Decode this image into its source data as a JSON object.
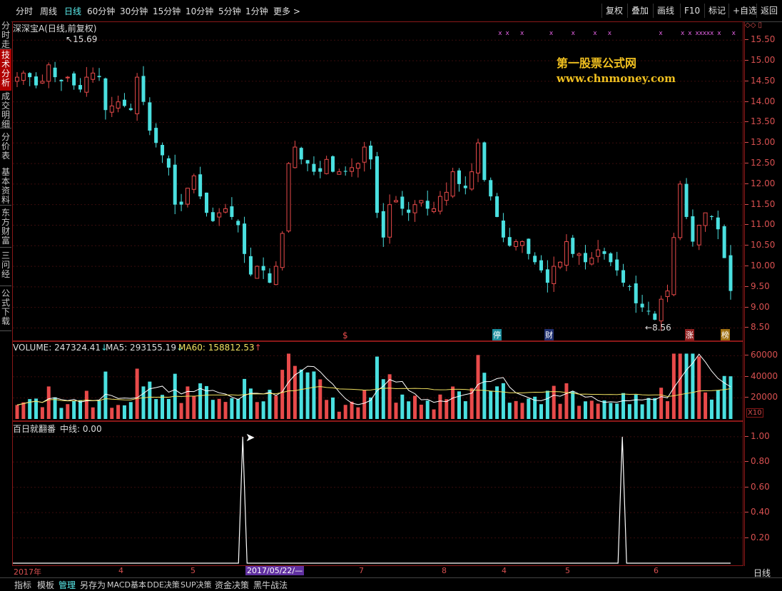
{
  "topbar": {
    "periods": [
      "分时",
      "周线",
      "日线",
      "60分钟",
      "30分钟",
      "15分钟",
      "10分钟",
      "5分钟",
      "1分钟",
      "更多 >"
    ],
    "active_period": "日线",
    "right_buttons": [
      "复权",
      "叠加",
      "画线",
      "F10",
      "标记",
      "+自选",
      "返回"
    ]
  },
  "sidebar": {
    "tabs": [
      "分时走势",
      "技术分析",
      "成交明细",
      "分价表",
      "基本资料",
      "东方财富",
      "三问经",
      "公式下载"
    ],
    "active": "技术分析"
  },
  "main": {
    "title": "深深宝A(日线,前复权)",
    "high_label": "15.69",
    "low_label": "8.56",
    "watermark_line1": "第一股票公式网",
    "watermark_line2": "www.chnmoney.com",
    "event_marks": [
      "$",
      "停",
      "财",
      "涨",
      "榜"
    ],
    "yticks": [
      "15.50",
      "15.00",
      "14.50",
      "14.00",
      "13.50",
      "13.00",
      "12.50",
      "12.00",
      "11.50",
      "11.00",
      "10.50",
      "10.00",
      "9.50",
      "9.00",
      "8.50"
    ]
  },
  "volume": {
    "label_volume": "VOLUME: 247324.41",
    "label_ma5": "MA5: 293155.19",
    "label_ma60": "MA60: 158812.53",
    "yticks": [
      "60000",
      "40000",
      "20000"
    ],
    "unit": "X10"
  },
  "indicator": {
    "label_name": "百日就翻番",
    "label_mid": "中线: 0.00",
    "yticks": [
      "1.00",
      "0.80",
      "0.60",
      "0.40",
      "0.20"
    ]
  },
  "date_axis": {
    "labels": [
      "2017年",
      "4",
      "5",
      "2017/05/22/—",
      "7",
      "8",
      "4",
      "5",
      "6"
    ],
    "period": "日线"
  },
  "bottombar": {
    "items": [
      "指标",
      "模板",
      "管理",
      "另存为",
      "MACD基本",
      "DDE决策",
      "SUP决策",
      "资金决策",
      "黑牛战法"
    ],
    "active": "管理"
  },
  "colors": {
    "up": "#e84a4a",
    "down": "#4ae0e0",
    "axis": "#d85050",
    "border": "#8a1818",
    "watermark": "#f0c020"
  },
  "chart_data": {
    "type": "candlestick",
    "title": "深深宝A(日线,前复权)",
    "ylim": [
      8.3,
      15.8
    ],
    "price_high": 15.69,
    "price_low": 8.56,
    "close_path": [
      14.6,
      14.7,
      14.6,
      14.4,
      14.5,
      14.9,
      14.6,
      14.5,
      14.6,
      14.4,
      14.3,
      14.6,
      14.7,
      14.6,
      13.8,
      13.9,
      14.0,
      13.9,
      13.8,
      14.6,
      14.0,
      13.3,
      13.0,
      12.7,
      12.4,
      11.5,
      11.5,
      11.9,
      12.2,
      11.7,
      11.3,
      11.1,
      11.3,
      11.4,
      11.2,
      11.0,
      10.3,
      9.8,
      10.0,
      9.9,
      9.6,
      10.0,
      10.8,
      12.5,
      12.9,
      12.6,
      12.5,
      12.3,
      12.3,
      12.6,
      12.3,
      12.3,
      12.3,
      12.4,
      12.5,
      12.9,
      12.6,
      11.3,
      10.7,
      11.5,
      11.6,
      11.4,
      11.3,
      11.5,
      11.6,
      11.4,
      11.4,
      11.7,
      11.8,
      12.3,
      12.0,
      11.9,
      12.3,
      13.0,
      12.1,
      11.7,
      11.2,
      10.7,
      10.5,
      10.6,
      10.6,
      10.3,
      10.1,
      9.9,
      9.6,
      10.0,
      10.1,
      10.6,
      10.3,
      10.3,
      10.1,
      10.2,
      10.4,
      10.3,
      10.1,
      9.9,
      9.6,
      9.5,
      9.1,
      9.0,
      8.9,
      8.7,
      9.2,
      9.4,
      10.7,
      12.0,
      11.2,
      10.6,
      11.0,
      11.3,
      11.2,
      10.9,
      10.2,
      9.4
    ],
    "volume_ma5": 293155.19,
    "volume_ma60": 158812.53,
    "volume_ylim": [
      0,
      65000
    ],
    "indicator": {
      "name": "百日就翻番",
      "ylim": [
        0,
        1.05
      ],
      "signal_positions": [
        0.315,
        0.835
      ]
    }
  }
}
